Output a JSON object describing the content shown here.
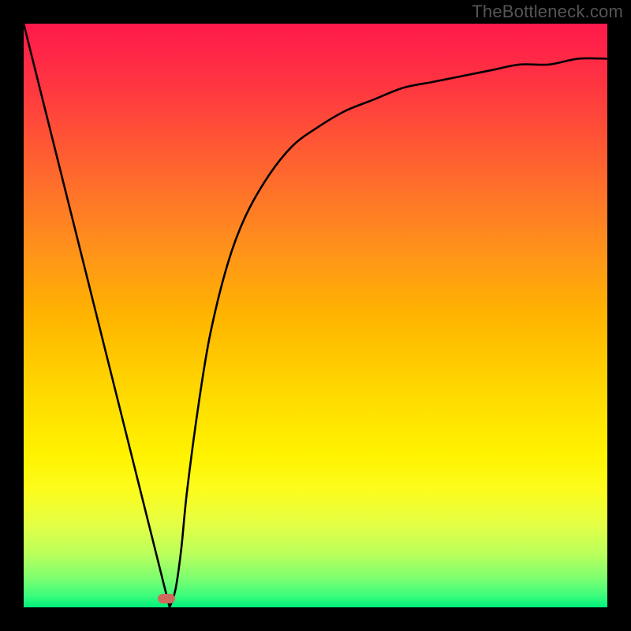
{
  "watermark": "TheBottleneck.com",
  "gradient_stops": [
    {
      "offset": 0.0,
      "color": "#ff1a4b"
    },
    {
      "offset": 0.05,
      "color": "#ff2647"
    },
    {
      "offset": 0.12,
      "color": "#ff3a3f"
    },
    {
      "offset": 0.2,
      "color": "#ff5535"
    },
    {
      "offset": 0.3,
      "color": "#ff7628"
    },
    {
      "offset": 0.4,
      "color": "#ff9618"
    },
    {
      "offset": 0.5,
      "color": "#ffb400"
    },
    {
      "offset": 0.58,
      "color": "#ffcb00"
    },
    {
      "offset": 0.66,
      "color": "#ffe000"
    },
    {
      "offset": 0.74,
      "color": "#fff300"
    },
    {
      "offset": 0.8,
      "color": "#fcfc1e"
    },
    {
      "offset": 0.86,
      "color": "#e3ff46"
    },
    {
      "offset": 0.91,
      "color": "#b8ff5c"
    },
    {
      "offset": 0.95,
      "color": "#7dff70"
    },
    {
      "offset": 0.98,
      "color": "#3cfc7c"
    },
    {
      "offset": 1.0,
      "color": "#00f07b"
    }
  ],
  "marker": {
    "x_frac": 0.245,
    "y_frac": 0.985
  },
  "chart_data": {
    "type": "line",
    "title": "",
    "xlabel": "",
    "ylabel": "",
    "xlim": [
      0,
      1
    ],
    "ylim": [
      0,
      1
    ],
    "annotations": [
      "TheBottleneck.com"
    ],
    "series": [
      {
        "name": "bottleneck-curve",
        "x": [
          0.0,
          0.02,
          0.05,
          0.08,
          0.11,
          0.14,
          0.17,
          0.2,
          0.22,
          0.24,
          0.25,
          0.26,
          0.27,
          0.28,
          0.3,
          0.32,
          0.35,
          0.38,
          0.42,
          0.46,
          0.5,
          0.55,
          0.6,
          0.65,
          0.7,
          0.75,
          0.8,
          0.85,
          0.9,
          0.95,
          1.0
        ],
        "y": [
          1.0,
          0.92,
          0.8,
          0.68,
          0.56,
          0.44,
          0.32,
          0.2,
          0.12,
          0.04,
          0.0,
          0.03,
          0.1,
          0.2,
          0.35,
          0.47,
          0.59,
          0.67,
          0.74,
          0.79,
          0.82,
          0.85,
          0.87,
          0.89,
          0.9,
          0.91,
          0.92,
          0.93,
          0.93,
          0.94,
          0.94
        ]
      }
    ]
  }
}
